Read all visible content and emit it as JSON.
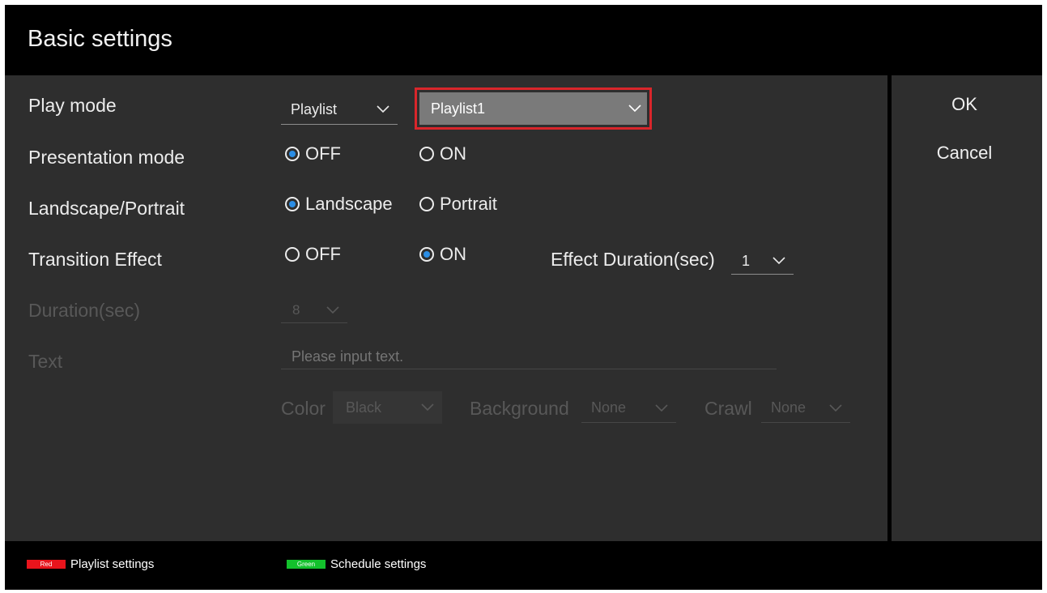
{
  "title": "Basic settings",
  "labels": {
    "play_mode": "Play mode",
    "presentation_mode": "Presentation mode",
    "orientation": "Landscape/Portrait",
    "transition_effect": "Transition Effect",
    "duration": "Duration(sec)",
    "text": "Text"
  },
  "play_mode": {
    "type_value": "Playlist",
    "playlist_value": "Playlist1"
  },
  "presentation": {
    "off_label": "OFF",
    "on_label": "ON",
    "selected": "OFF"
  },
  "orientation": {
    "landscape_label": "Landscape",
    "portrait_label": "Portrait",
    "selected": "Landscape"
  },
  "transition": {
    "off_label": "OFF",
    "on_label": "ON",
    "selected": "ON",
    "effect_duration_label": "Effect Duration(sec)",
    "effect_duration_value": "1"
  },
  "duration": {
    "value": "8"
  },
  "text": {
    "placeholder": "Please input text.",
    "color_label": "Color",
    "color_value": "Black",
    "background_label": "Background",
    "background_value": "None",
    "crawl_label": "Crawl",
    "crawl_value": "None"
  },
  "buttons": {
    "ok": "OK",
    "cancel": "Cancel"
  },
  "footer": {
    "red_key": "Red",
    "red_label": "Playlist settings",
    "green_key": "Green",
    "green_label": "Schedule settings"
  },
  "colors": {
    "background": "#2e2e2e",
    "header": "#000000",
    "radio_selected": "#2b8ee6",
    "focus_border": "#d9262b",
    "red_key": "#e8141c",
    "green_key": "#13c12c"
  },
  "icons": {
    "dropdown": "chevron-down-icon",
    "radio": "radio-button-icon"
  }
}
